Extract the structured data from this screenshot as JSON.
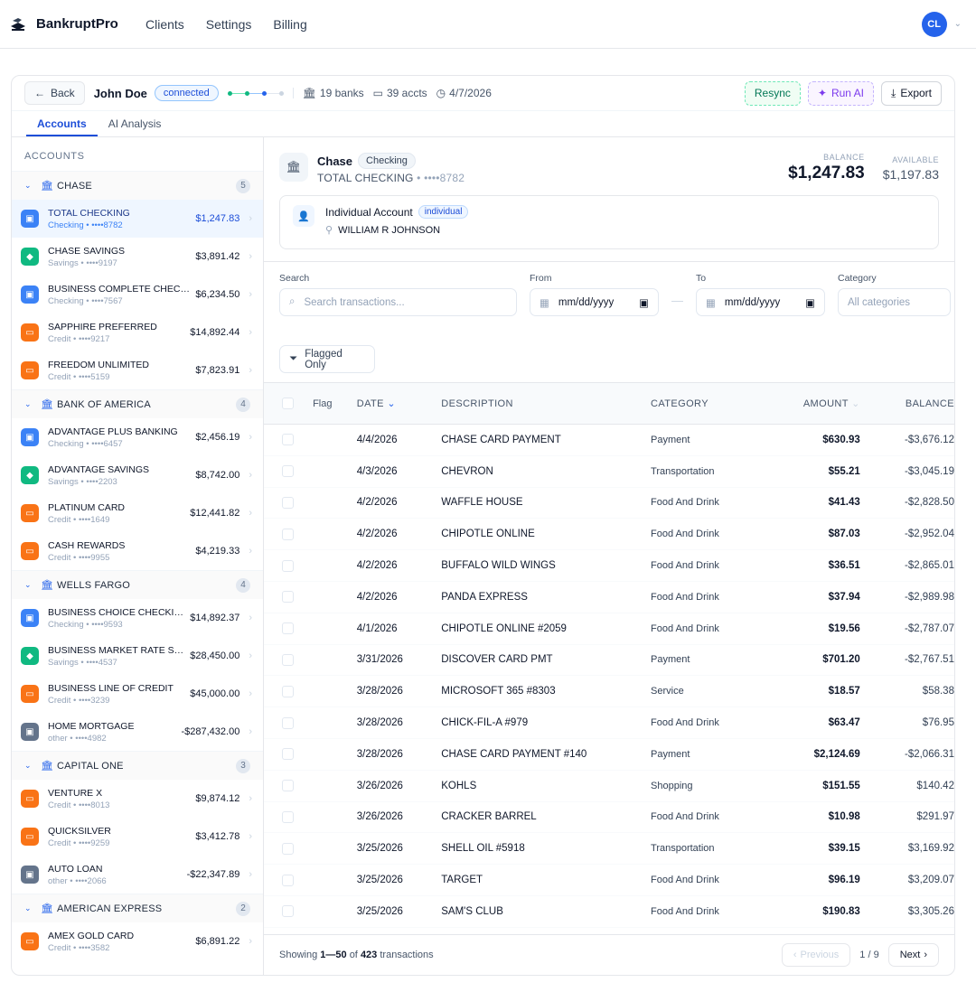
{
  "app": {
    "brand": "BankruptPro",
    "nav": [
      "Clients",
      "Settings",
      "Billing"
    ],
    "user_initials": "CL"
  },
  "header": {
    "back_label": "Back",
    "client_name": "John Doe",
    "status": "connected",
    "banks": "19 banks",
    "accts": "39 accts",
    "date": "4/7/2026",
    "resync_label": "Resync",
    "run_ai_label": "Run AI",
    "export_label": "Export"
  },
  "tabs": [
    {
      "label": "Accounts",
      "active": true
    },
    {
      "label": "AI Analysis",
      "active": false
    }
  ],
  "sidebar": {
    "title": "ACCOUNTS",
    "banks": [
      {
        "name": "CHASE",
        "count": "5",
        "accounts": [
          {
            "name": "TOTAL CHECKING",
            "sub": "Checking • ••••8782",
            "balance": "$1,247.83",
            "kind": "checking",
            "selected": true
          },
          {
            "name": "CHASE SAVINGS",
            "sub": "Savings • ••••9197",
            "balance": "$3,891.42",
            "kind": "savings"
          },
          {
            "name": "BUSINESS COMPLETE CHECKING",
            "sub": "Checking • ••••7567",
            "balance": "$6,234.50",
            "kind": "checking"
          },
          {
            "name": "SAPPHIRE PREFERRED",
            "sub": "Credit • ••••9217",
            "balance": "$14,892.44",
            "kind": "credit"
          },
          {
            "name": "FREEDOM UNLIMITED",
            "sub": "Credit • ••••5159",
            "balance": "$7,823.91",
            "kind": "credit"
          }
        ]
      },
      {
        "name": "BANK OF AMERICA",
        "count": "4",
        "accounts": [
          {
            "name": "ADVANTAGE PLUS BANKING",
            "sub": "Checking • ••••6457",
            "balance": "$2,456.19",
            "kind": "checking"
          },
          {
            "name": "ADVANTAGE SAVINGS",
            "sub": "Savings • ••••2203",
            "balance": "$8,742.00",
            "kind": "savings"
          },
          {
            "name": "PLATINUM CARD",
            "sub": "Credit • ••••1649",
            "balance": "$12,441.82",
            "kind": "credit"
          },
          {
            "name": "CASH REWARDS",
            "sub": "Credit • ••••9955",
            "balance": "$4,219.33",
            "kind": "credit"
          }
        ]
      },
      {
        "name": "WELLS FARGO",
        "count": "4",
        "accounts": [
          {
            "name": "BUSINESS CHOICE CHECKING",
            "sub": "Checking • ••••9593",
            "balance": "$14,892.37",
            "kind": "checking"
          },
          {
            "name": "BUSINESS MARKET RATE SAVINGS",
            "sub": "Savings • ••••4537",
            "balance": "$28,450.00",
            "kind": "savings"
          },
          {
            "name": "BUSINESS LINE OF CREDIT",
            "sub": "Credit • ••••3239",
            "balance": "$45,000.00",
            "kind": "credit"
          },
          {
            "name": "HOME MORTGAGE",
            "sub": "other • ••••4982",
            "balance": "-$287,432.00",
            "kind": "other"
          }
        ]
      },
      {
        "name": "CAPITAL ONE",
        "count": "3",
        "accounts": [
          {
            "name": "VENTURE X",
            "sub": "Credit • ••••8013",
            "balance": "$9,874.12",
            "kind": "credit"
          },
          {
            "name": "QUICKSILVER",
            "sub": "Credit • ••••9259",
            "balance": "$3,412.78",
            "kind": "credit"
          },
          {
            "name": "AUTO LOAN",
            "sub": "other • ••••2066",
            "balance": "-$22,347.89",
            "kind": "other"
          }
        ]
      },
      {
        "name": "AMERICAN EXPRESS",
        "count": "2",
        "accounts": [
          {
            "name": "AMEX GOLD CARD",
            "sub": "Credit • ••••3582",
            "balance": "$6,891.22",
            "kind": "credit"
          }
        ]
      }
    ]
  },
  "summary": {
    "bank": "Chase",
    "type": "Checking",
    "account_name": "TOTAL CHECKING",
    "mask": "• ••••8782",
    "balance_label": "BALANCE",
    "balance": "$1,247.83",
    "available_label": "AVAILABLE",
    "available": "$1,197.83",
    "owner_title": "Individual Account",
    "owner_badge": "individual",
    "owner_name": "WILLIAM R JOHNSON"
  },
  "filters": {
    "search_label": "Search",
    "search_placeholder": "Search transactions...",
    "from_label": "From",
    "from_value": "mm/dd/yyyy",
    "to_label": "To",
    "to_value": "mm/dd/yyyy",
    "category_label": "Category",
    "category_value": "All categories",
    "flagged_label": "Flagged Only"
  },
  "table": {
    "headers": {
      "flag": "Flag",
      "date": "DATE",
      "description": "DESCRIPTION",
      "category": "CATEGORY",
      "amount": "AMOUNT",
      "balance": "BALANCE"
    },
    "rows": [
      {
        "date": "4/4/2026",
        "desc": "CHASE CARD PAYMENT",
        "cat": "Payment",
        "amt": "$630.93",
        "bal": "-$3,676.12"
      },
      {
        "date": "4/3/2026",
        "desc": "CHEVRON",
        "cat": "Transportation",
        "amt": "$55.21",
        "bal": "-$3,045.19"
      },
      {
        "date": "4/2/2026",
        "desc": "WAFFLE HOUSE",
        "cat": "Food And Drink",
        "amt": "$41.43",
        "bal": "-$2,828.50"
      },
      {
        "date": "4/2/2026",
        "desc": "CHIPOTLE ONLINE",
        "cat": "Food And Drink",
        "amt": "$87.03",
        "bal": "-$2,952.04"
      },
      {
        "date": "4/2/2026",
        "desc": "BUFFALO WILD WINGS",
        "cat": "Food And Drink",
        "amt": "$36.51",
        "bal": "-$2,865.01"
      },
      {
        "date": "4/2/2026",
        "desc": "PANDA EXPRESS",
        "cat": "Food And Drink",
        "amt": "$37.94",
        "bal": "-$2,989.98"
      },
      {
        "date": "4/1/2026",
        "desc": "CHIPOTLE ONLINE #2059",
        "cat": "Food And Drink",
        "amt": "$19.56",
        "bal": "-$2,787.07"
      },
      {
        "date": "3/31/2026",
        "desc": "DISCOVER CARD PMT",
        "cat": "Payment",
        "amt": "$701.20",
        "bal": "-$2,767.51"
      },
      {
        "date": "3/28/2026",
        "desc": "MICROSOFT 365 #8303",
        "cat": "Service",
        "amt": "$18.57",
        "bal": "$58.38"
      },
      {
        "date": "3/28/2026",
        "desc": "CHICK-FIL-A #979",
        "cat": "Food And Drink",
        "amt": "$63.47",
        "bal": "$76.95"
      },
      {
        "date": "3/28/2026",
        "desc": "CHASE CARD PAYMENT #140",
        "cat": "Payment",
        "amt": "$2,124.69",
        "bal": "-$2,066.31"
      },
      {
        "date": "3/26/2026",
        "desc": "KOHLS",
        "cat": "Shopping",
        "amt": "$151.55",
        "bal": "$140.42"
      },
      {
        "date": "3/26/2026",
        "desc": "CRACKER BARREL",
        "cat": "Food And Drink",
        "amt": "$10.98",
        "bal": "$291.97"
      },
      {
        "date": "3/25/2026",
        "desc": "SHELL OIL #5918",
        "cat": "Transportation",
        "amt": "$39.15",
        "bal": "$3,169.92"
      },
      {
        "date": "3/25/2026",
        "desc": "TARGET",
        "cat": "Food And Drink",
        "amt": "$96.19",
        "bal": "$3,209.07"
      },
      {
        "date": "3/25/2026",
        "desc": "SAM'S CLUB",
        "cat": "Food And Drink",
        "amt": "$190.83",
        "bal": "$3,305.26"
      }
    ]
  },
  "footer": {
    "showing_prefix": "Showing",
    "range": "1—50",
    "of": "of",
    "total": "423",
    "suffix": "transactions",
    "prev_label": "Previous",
    "page": "1 / 9",
    "next_label": "Next"
  },
  "colors": {
    "primary": "#2563eb",
    "checking": "#3b82f6",
    "savings": "#10b981",
    "credit": "#f97316",
    "other": "#64748b"
  }
}
